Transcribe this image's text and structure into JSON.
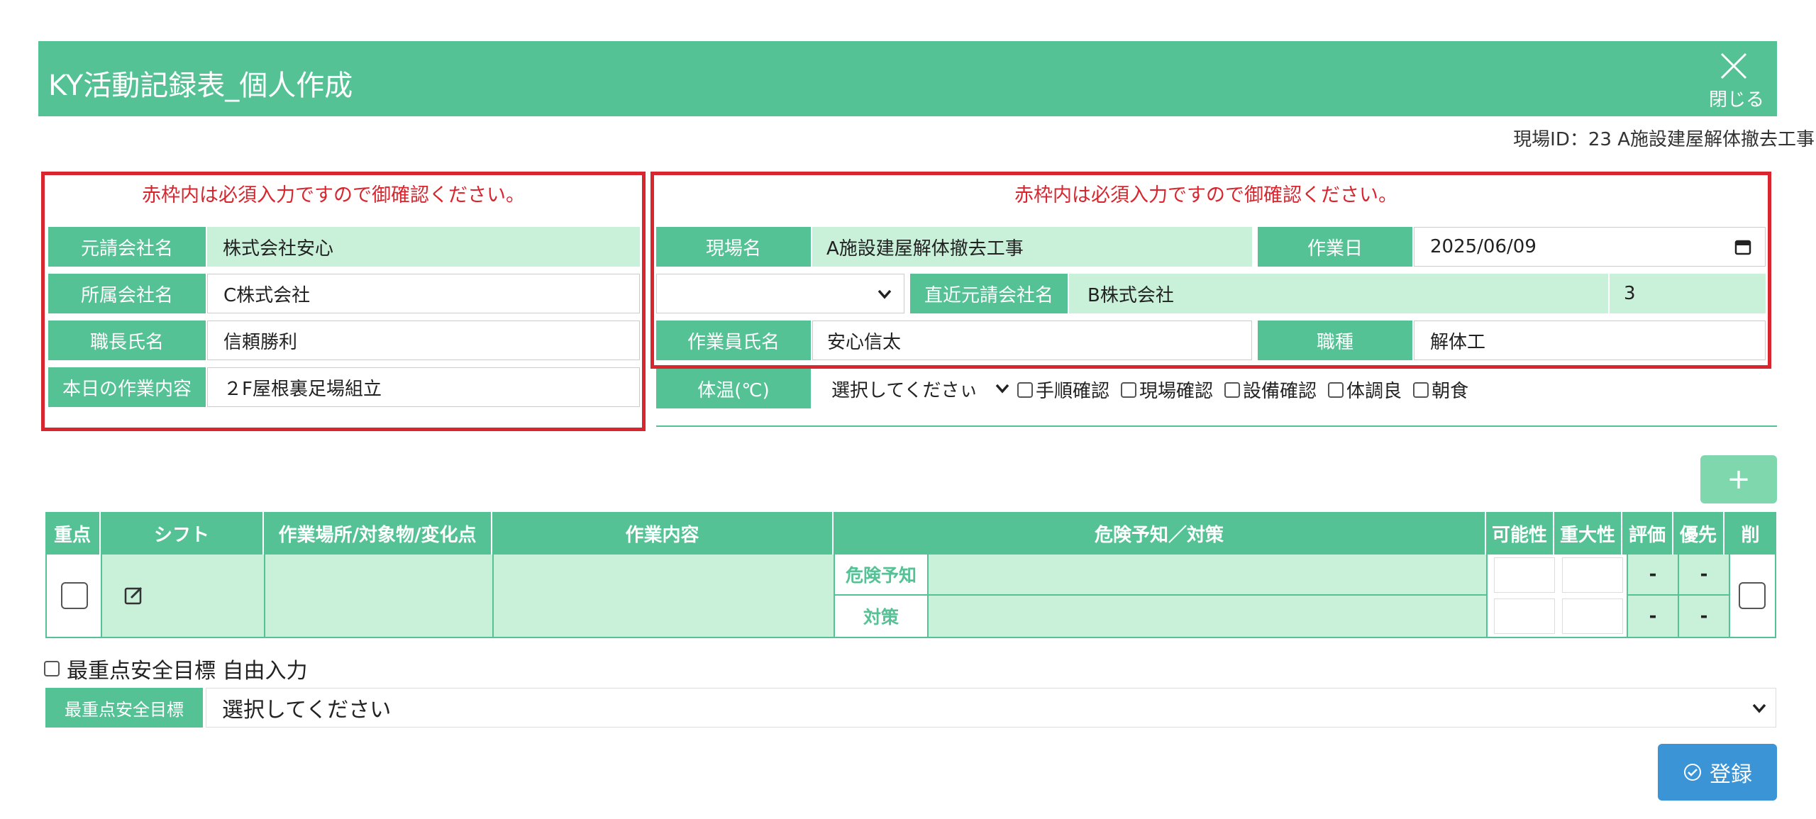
{
  "header": {
    "title": "KY活動記録表_個人作成",
    "close_label": "閉じる"
  },
  "site_id_text": "現場ID：23 A施設建屋解体撤去工事",
  "notice_text": "赤枠内は必須入力ですので御確認ください。",
  "left_form": {
    "prime_contractor_label": "元請会社名",
    "prime_contractor_value": "株式会社安心",
    "affiliated_company_label": "所属会社名",
    "affiliated_company_value": "C株式会社",
    "foreman_label": "職長氏名",
    "foreman_value": "信頼勝利",
    "todays_work_label": "本日の作業内容",
    "todays_work_value": "２F屋根裏足場組立"
  },
  "right_form": {
    "site_name_label": "現場名",
    "site_name_value": "A施設建屋解体撤去工事",
    "work_date_label": "作業日",
    "work_date_value": "2025/06/09",
    "direct_contractor_label": "直近元請会社名",
    "direct_contractor_value": "B株式会社",
    "tier_value": "3",
    "worker_name_label": "作業員氏名",
    "worker_name_value": "安心信太",
    "job_type_label": "職種",
    "job_type_value": "解体工",
    "temperature_label": "体温(℃)",
    "temperature_select": "選択してくださぃ",
    "checks": [
      "手順確認",
      "現場確認",
      "設備確認",
      "体調良",
      "朝食"
    ]
  },
  "add_button_label": "+",
  "table": {
    "headers": [
      "重点",
      "シフト",
      "作業場所/対象物/変化点",
      "作業内容",
      "危険予知／対策",
      "可能性",
      "重大性",
      "評価",
      "優先",
      "削"
    ],
    "risk_label": "危険予知",
    "measure_label": "対策",
    "eval_placeholder": "-"
  },
  "goal_free_input_label": "最重点安全目標 自由入力",
  "goal_label": "最重点安全目標",
  "goal_select_value": "選択してください",
  "register_button": "登録",
  "colors": {
    "primary": "#54c294",
    "light": "#c9f0d9",
    "required_border": "#d8252e",
    "register": "#3a94d6"
  }
}
